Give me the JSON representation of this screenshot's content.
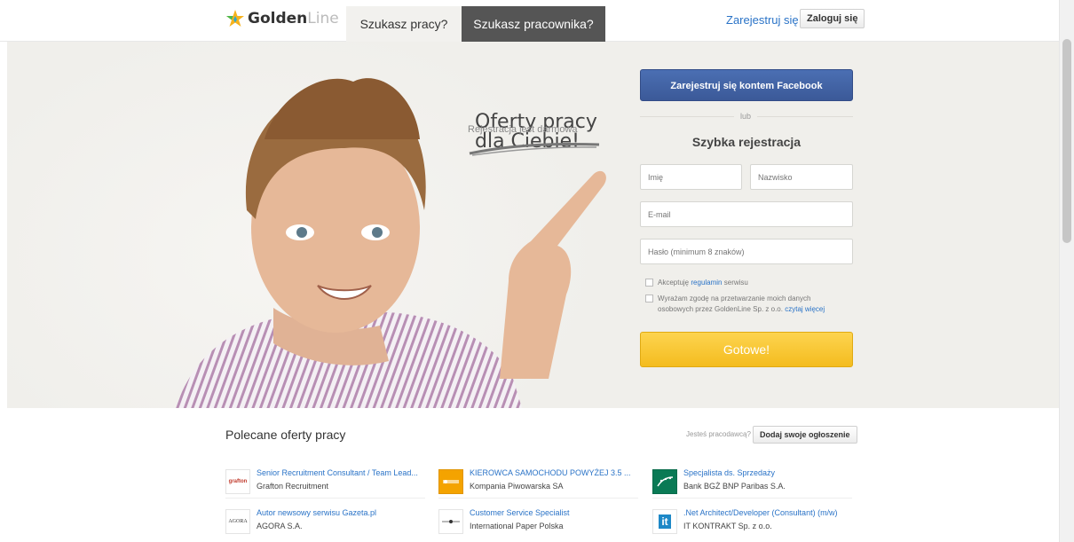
{
  "header": {
    "logo_bold": "Golden",
    "logo_light": "Line",
    "tabs": [
      {
        "label": "Szukasz pracy?"
      },
      {
        "label": "Szukasz pracownika?"
      }
    ],
    "register_link": "Zarejestruj się",
    "login_button": "Zaloguj się"
  },
  "hero": {
    "headline_line1": "Oferty pracy",
    "headline_line2": "dla Ciebie!",
    "subtitle": "Rejestracja jest darmowa"
  },
  "form": {
    "facebook_button": "Zarejestruj się kontem Facebook",
    "or_label": "lub",
    "title": "Szybka rejestracja",
    "first_name_placeholder": "Imię",
    "last_name_placeholder": "Nazwisko",
    "email_placeholder": "E-mail",
    "password_placeholder": "Hasło (minimum 8 znaków)",
    "accept_prefix": "Akceptuję",
    "accept_link": "regulamin",
    "accept_suffix": "serwisu",
    "consent_text": "Wyrażam zgodę na przetwarzanie moich danych osobowych przez GoldenLine Sp. z o.o.",
    "consent_link": "czytaj więcej",
    "submit_button": "Gotowe!"
  },
  "recommended": {
    "title": "Polecane oferty pracy",
    "employer_question": "Jesteś pracodawcą?",
    "add_button": "Dodaj swoje ogłoszenie",
    "jobs": [
      {
        "title": "Senior Recruitment Consultant / Team Lead...",
        "company": "Grafton Recruitment",
        "logo": "grafton"
      },
      {
        "title": "KIEROWCA SAMOCHODU POWYŻEJ 3.5 ...",
        "company": "Kompania Piwowarska SA",
        "logo": "kompania"
      },
      {
        "title": "Specjalista ds. Sprzedaży",
        "company": "Bank BGŻ BNP Paribas S.A.",
        "logo": "bnp"
      },
      {
        "title": "Autor newsowy serwisu Gazeta.pl",
        "company": "AGORA S.A.",
        "logo": "AGORA"
      },
      {
        "title": "Customer Service Specialist",
        "company": "International Paper Polska",
        "logo": "ip"
      },
      {
        "title": ".Net Architect/Developer (Consultant) (m/w)",
        "company": "IT KONTRAKT Sp. z o.o.",
        "logo": "it"
      }
    ]
  },
  "colors": {
    "accent_blue": "#2a73c7",
    "facebook": "#3b5998",
    "submit_yellow": "#f4bc1f",
    "hero_bg": "#f0efeb"
  }
}
